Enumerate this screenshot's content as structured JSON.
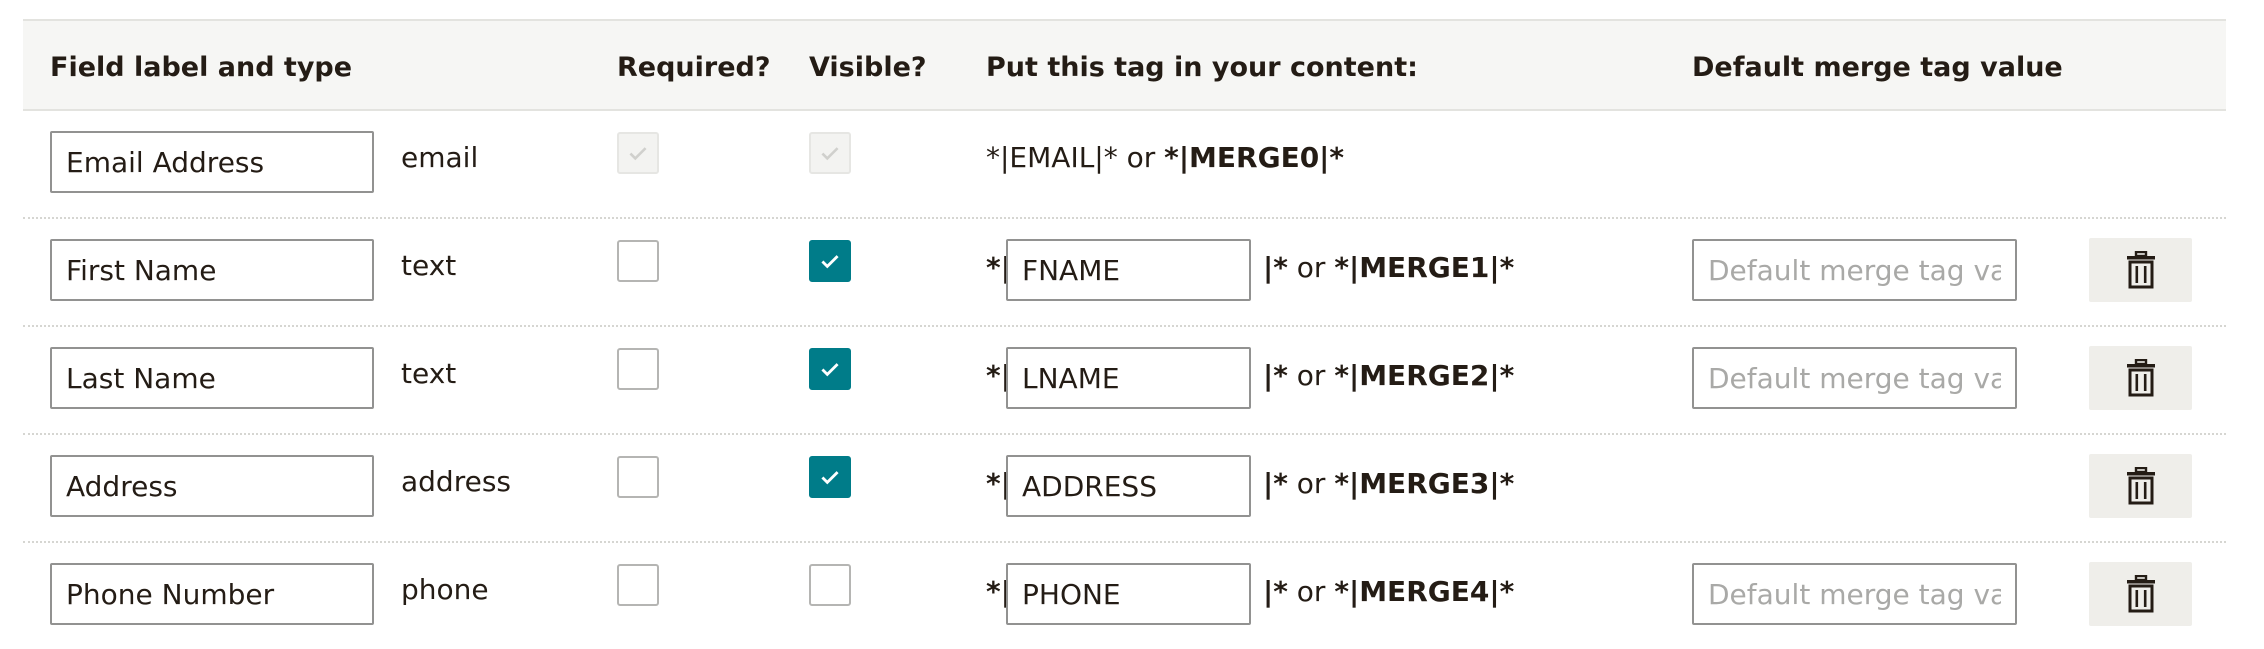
{
  "headers": {
    "field_label": "Field label and type",
    "required": "Required?",
    "visible": "Visible?",
    "tag": "Put this tag in your content:",
    "default": "Default merge tag value"
  },
  "tag_prefix": "*|",
  "tag_suffix_or": "|* or ",
  "default_placeholder": "Default merge tag valu",
  "rows": [
    {
      "label": "Email Address",
      "type": "email",
      "required": true,
      "visible": true,
      "locked": true,
      "tag_plain": "*|EMAIL|* or ",
      "merge": "*|MERGE0|*"
    },
    {
      "label": "First Name",
      "type": "text",
      "required": false,
      "visible": true,
      "tag": "FNAME",
      "merge": "*|MERGE1|*"
    },
    {
      "label": "Last Name",
      "type": "text",
      "required": false,
      "visible": true,
      "tag": "LNAME",
      "merge": "*|MERGE2|*"
    },
    {
      "label": "Address",
      "type": "address",
      "required": false,
      "visible": true,
      "tag": "ADDRESS",
      "merge": "*|MERGE3|*"
    },
    {
      "label": "Phone Number",
      "type": "phone",
      "required": false,
      "visible": false,
      "tag": "PHONE",
      "merge": "*|MERGE4|*"
    }
  ],
  "colors": {
    "accent": "#007c89",
    "header_bg": "#f6f6f4",
    "button_bg": "#efeeea"
  },
  "icons": {
    "check": "check-icon",
    "delete": "trash-icon"
  }
}
